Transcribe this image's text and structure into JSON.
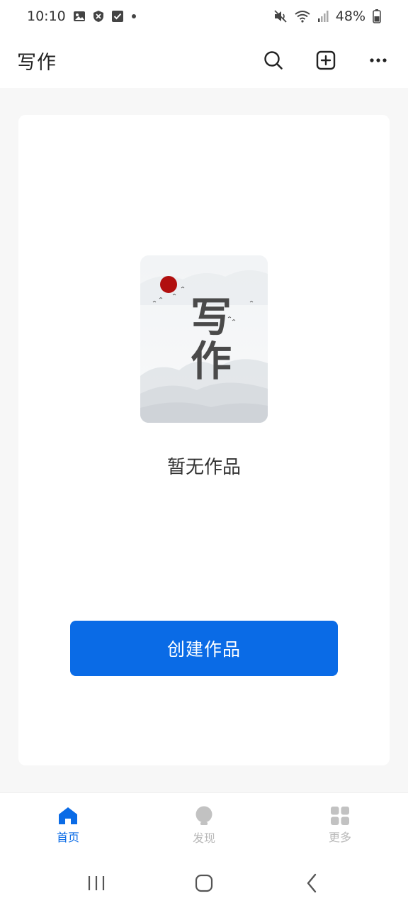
{
  "status_bar": {
    "time": "10:10",
    "battery": "48%",
    "left_icons": [
      "image-icon",
      "shield-x-icon",
      "checkbox-icon",
      "dot-icon"
    ],
    "right_icons": [
      "mute-icon",
      "wifi-icon",
      "signal-icon",
      "battery-icon"
    ]
  },
  "app_bar": {
    "title": "写作",
    "actions": [
      "search-icon",
      "add-square-icon",
      "more-icon"
    ]
  },
  "main": {
    "cover_title": "写作",
    "empty_text": "暂无作品",
    "create_button": "创建作品"
  },
  "bottom_nav": {
    "items": [
      {
        "label": "首页",
        "icon": "home-icon",
        "active": true
      },
      {
        "label": "发现",
        "icon": "bulb-icon",
        "active": false
      },
      {
        "label": "更多",
        "icon": "grid-icon",
        "active": false
      }
    ]
  },
  "colors": {
    "accent": "#0a6be6",
    "inactive": "#b8b8b8",
    "background": "#f7f7f7",
    "sun_red": "#b10f0f"
  }
}
